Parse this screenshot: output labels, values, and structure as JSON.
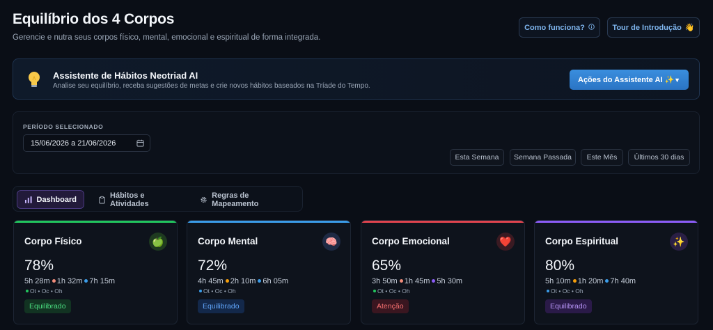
{
  "header": {
    "title": "Equilíbrio dos 4 Corpos",
    "subtitle": "Gerencie e nutra seus corpos físico, mental, emocional e espiritual de forma integrada.",
    "how_it_works": "Como funciona?",
    "how_icon": "info-icon",
    "tour": "Tour de Introdução",
    "tour_icon": "waving-hand-icon"
  },
  "assistant": {
    "title": "Assistente de Hábitos Neotriad AI",
    "description": "Analise seu equilíbrio, receba sugestões de metas e crie novos hábitos baseados na Tríade do Tempo.",
    "actions_label": "Ações do Assistente AI ✨",
    "icon": "lightbulb-icon"
  },
  "period": {
    "label": "PERÍODO SELECIONADO",
    "date_range": "15/06/2026 a 21/06/2026",
    "ranges": [
      "Esta Semana",
      "Semana Passada",
      "Este Mês",
      "Últimos 30 dias"
    ]
  },
  "tabs": [
    {
      "label": "Dashboard",
      "icon": "bar-chart-icon",
      "active": true
    },
    {
      "label": "Hábitos e Atividades",
      "icon": "clipboard-icon",
      "active": false
    },
    {
      "label": "Regras de Mapeamento",
      "icon": "gear-icon",
      "active": false
    }
  ],
  "colors": {
    "green": "#22c55e",
    "blue": "#3b9ce8",
    "red": "#e0444f",
    "purple": "#8b5cf6",
    "orange": "#f59e0b",
    "salmon": "#f08c7a"
  },
  "cards": [
    {
      "title": "Corpo Físico",
      "emoji": "🍏",
      "percent": "78%",
      "times": [
        "5h 28m",
        "1h 32m",
        "7h 15m"
      ],
      "legend": [
        "Ot",
        "Oc",
        "Oh"
      ],
      "badge": "Equilibrado",
      "status": "ok"
    },
    {
      "title": "Corpo Mental",
      "emoji": "🧠",
      "percent": "72%",
      "times": [
        "4h 45m",
        "2h 10m",
        "6h 05m"
      ],
      "legend": [
        "Ot",
        "Oc",
        "Oh"
      ],
      "badge": "Equilibrado",
      "status": "ok"
    },
    {
      "title": "Corpo Emocional",
      "emoji": "❤️",
      "percent": "65%",
      "times": [
        "3h 50m",
        "1h 45m",
        "5h 30m"
      ],
      "legend": [
        "Ot",
        "Oc",
        "Oh"
      ],
      "badge": "Atenção",
      "status": "warn"
    },
    {
      "title": "Corpo Espiritual",
      "emoji": "✨",
      "percent": "80%",
      "times": [
        "5h 10m",
        "1h 20m",
        "7h 40m"
      ],
      "legend": [
        "Ot",
        "Oc",
        "Oh"
      ],
      "badge": "Equilibrado",
      "status": "ok"
    }
  ]
}
